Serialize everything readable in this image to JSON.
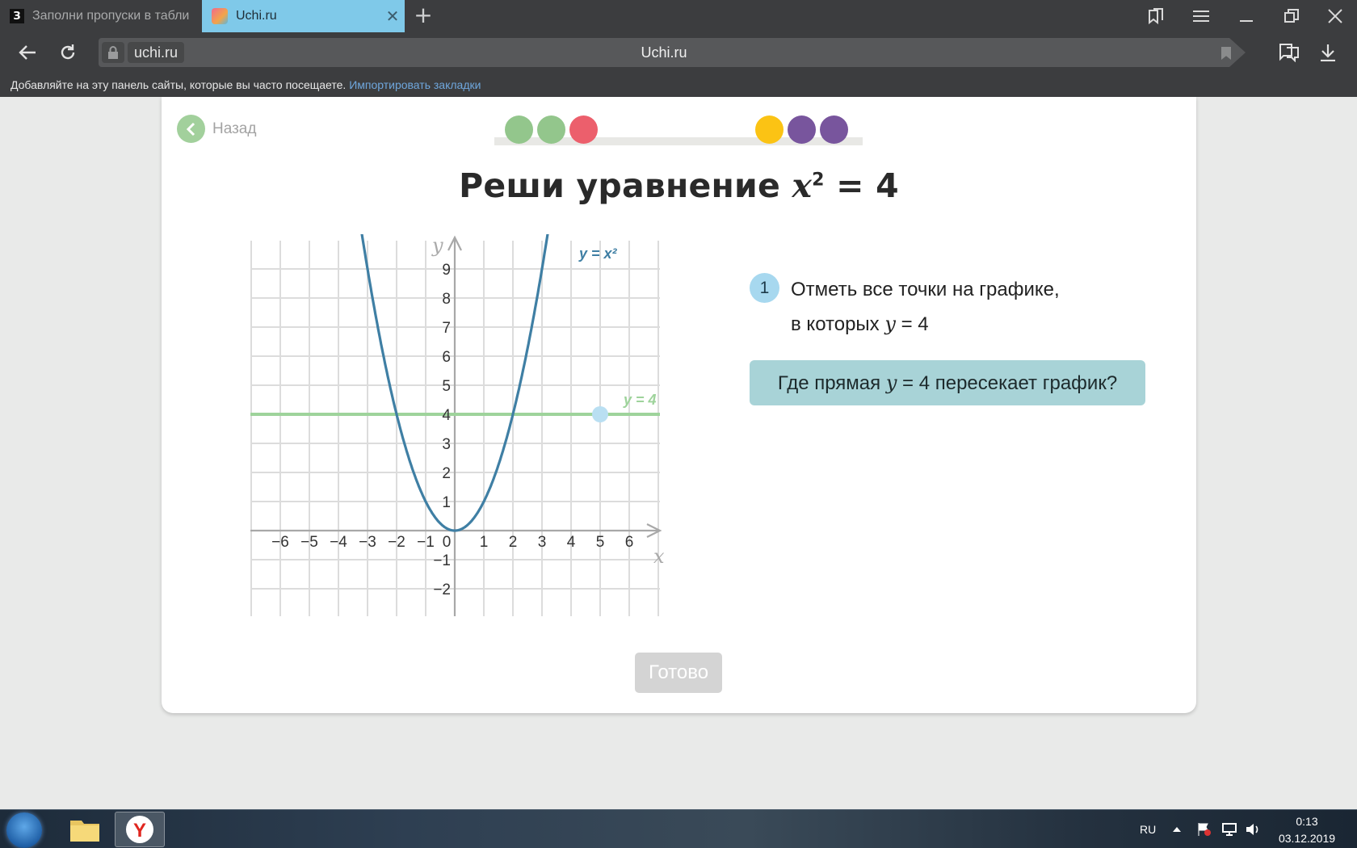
{
  "browser": {
    "tabs": [
      {
        "favicon_letter": "З",
        "title": "Заполни пропуски в табли"
      },
      {
        "title": "Uchi.ru"
      }
    ],
    "domain": "uchi.ru",
    "page_title": "Uchi.ru",
    "bookmarks_bar": {
      "text": "Добавляйте на эту панель сайты, которые вы часто посещаете.",
      "link": "Импортировать закладки"
    }
  },
  "page": {
    "back_label": "Назад",
    "progress_dots": [
      "#93c68c",
      "#93c68c",
      "#ec5f6c",
      "#fbc314",
      "#78559d",
      "#78559d"
    ],
    "heading": {
      "prefix": "Реши уравнение ",
      "var": "x",
      "exp": "2",
      "suffix": " = 4"
    },
    "task": {
      "number": "1",
      "line1": "Отметь все точки на графике,",
      "line2_prefix": "в которых ",
      "line2_var": "y",
      "line2_suffix": " = 4"
    },
    "hint": {
      "prefix": "Где прямая ",
      "var": "y",
      "suffix": " = 4  пересекает график?"
    },
    "ready_label": "Готово"
  },
  "chart_data": {
    "type": "line",
    "xlabel": "x",
    "ylabel": "y",
    "x_ticks": [
      "−6",
      "−5",
      "−4",
      "−3",
      "−2",
      "−1",
      "0",
      "1",
      "2",
      "3",
      "4",
      "5",
      "6"
    ],
    "y_ticks": [
      "9",
      "8",
      "7",
      "6",
      "5",
      "4",
      "3",
      "2",
      "1",
      "−1",
      "−2"
    ],
    "xlim": [
      -7,
      7
    ],
    "ylim": [
      -3,
      10
    ],
    "grid": true,
    "series": [
      {
        "name": "y = x²",
        "function": "x^2",
        "color": "#3f7fa4"
      },
      {
        "name": "y = 4",
        "constant": 4,
        "color": "#9ed39b"
      }
    ],
    "marked_points": [
      {
        "x": 5,
        "y": 4,
        "color": "#b9dff2"
      }
    ]
  },
  "taskbar": {
    "lang": "RU",
    "time": "0:13",
    "date": "03.12.2019"
  }
}
